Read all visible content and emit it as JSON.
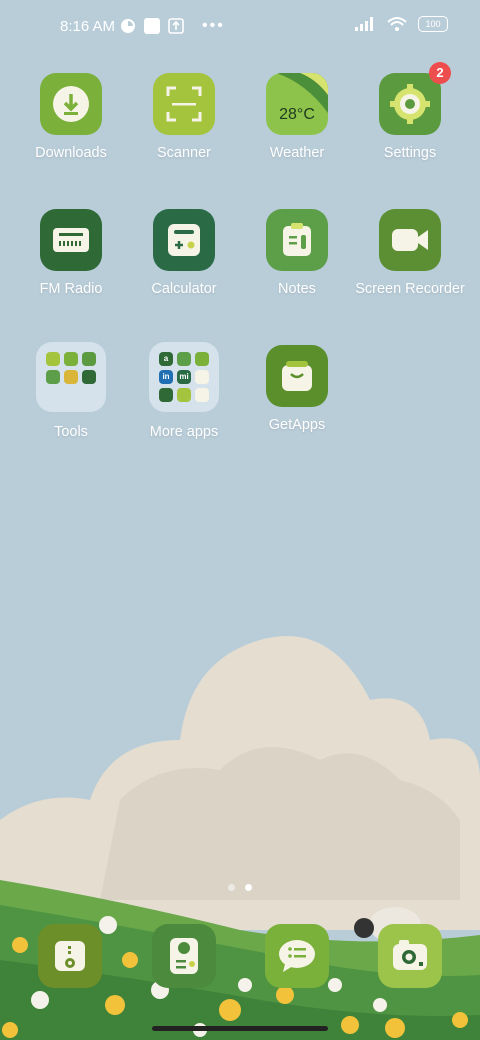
{
  "status_bar": {
    "time": "8:16 AM",
    "battery": "100",
    "icons": [
      "alarm-icon",
      "notification-square-icon",
      "upload-icon",
      "more-dots-icon",
      "signal-icon",
      "wifi-icon",
      "battery-icon"
    ]
  },
  "apps": [
    {
      "label": "Downloads",
      "icon": "download-icon",
      "color": "#7bb03b"
    },
    {
      "label": "Scanner",
      "icon": "scan-icon",
      "color": "#a4c43e"
    },
    {
      "label": "Weather",
      "icon": "weather-icon",
      "color": "#8ec34b",
      "widget_text": "28°C"
    },
    {
      "label": "Settings",
      "icon": "gear-icon",
      "color": "#5c9a3f",
      "badge": "2"
    },
    {
      "label": "FM Radio",
      "icon": "radio-icon",
      "color": "#2f6a36"
    },
    {
      "label": "Calculator",
      "icon": "calculator-icon",
      "color": "#2a6b45"
    },
    {
      "label": "Notes",
      "icon": "notes-icon",
      "color": "#5d9f49"
    },
    {
      "label": "Screen Recorder",
      "icon": "video-camera-icon",
      "color": "#5c8f34"
    },
    {
      "label": "Tools",
      "icon": "folder-icon"
    },
    {
      "label": "More apps",
      "icon": "folder-icon"
    },
    {
      "label": "GetApps",
      "icon": "shopping-bag-icon",
      "color": "#5b8f2c"
    }
  ],
  "more_apps_folder_glyphs": [
    "a",
    "in",
    "mi"
  ],
  "dock": [
    {
      "name": "phone-app",
      "icon": "phone-icon",
      "color": "#6d8f2a"
    },
    {
      "name": "security-app",
      "icon": "security-icon",
      "color": "#4c8a3d"
    },
    {
      "name": "messages-app",
      "icon": "message-icon",
      "color": "#7ab13b"
    },
    {
      "name": "camera-app",
      "icon": "camera-icon",
      "color": "#9cc34a"
    }
  ],
  "page_indicator": {
    "pages": 2,
    "active": 2
  }
}
